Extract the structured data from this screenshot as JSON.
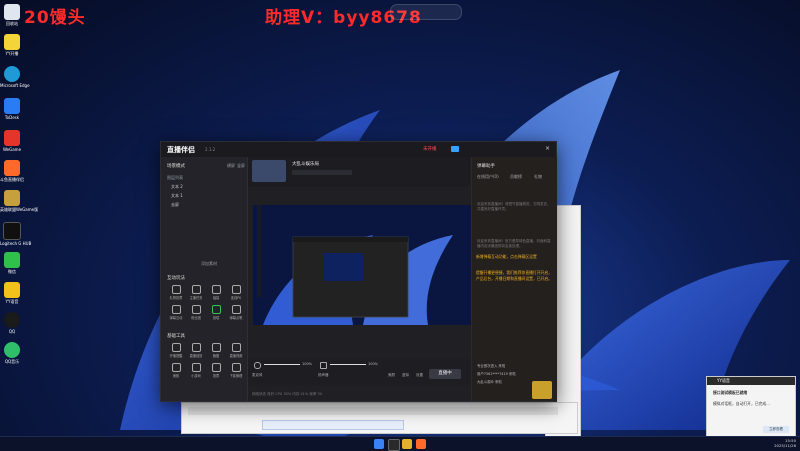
{
  "overlay": {
    "left": "20馒头",
    "right": "助理V：byy8678"
  },
  "desktop_icons": [
    {
      "label": "回收站",
      "color": "#dfe6f0"
    },
    {
      "label": "YY开播",
      "color": "#f3d53a"
    },
    {
      "label": "Microsoft Edge",
      "color": "#1f9ad6"
    },
    {
      "label": "ToDesk",
      "color": "#2a7cf5"
    },
    {
      "label": "WeGame",
      "color": "#e5352b"
    },
    {
      "label": "斗鱼直播伴侣",
      "color": "#ff6a2a"
    },
    {
      "label": "英雄联盟WeGame版",
      "color": "#c6a03c"
    },
    {
      "label": "Logitech G HUB",
      "color": "#101010"
    },
    {
      "label": "微信",
      "color": "#2fbf4a"
    },
    {
      "label": "YY语音",
      "color": "#f2c21a"
    },
    {
      "label": "QQ",
      "color": "#1a1a1a"
    },
    {
      "label": "QQ音乐",
      "color": "#2fbf6a"
    }
  ],
  "app": {
    "logo": "直播伴侣",
    "version": "2.1.2",
    "live_status": "未开播",
    "room_title": "大乱斗娱乐局",
    "sidebar": {
      "scene_label": "场景模式",
      "scene_tabs": [
        "横屏",
        "竖屏"
      ],
      "source_label": "图层列表",
      "items": [
        "文本 2",
        "文本 1",
        "去屏"
      ],
      "add_source": "添加素材",
      "interact_label": "互动玩法",
      "interact_icons": [
        "礼物投票",
        "主播任务",
        "福袋",
        "连线PK",
        "弹幕互动",
        "粉丝团",
        "投喂",
        "弹幕点歌"
      ],
      "tools_label": "基础工具",
      "tool_icons": [
        "开播提醒",
        "直播回放",
        "截图",
        "直播视频",
        "美颜",
        "小游戏",
        "投票",
        "下载管理"
      ]
    },
    "controls": {
      "mic_label": "麦克风",
      "mic_value": "100%",
      "speaker_label": "扬声器",
      "speaker_value": "100%",
      "mode_items": [
        "美颜",
        "虚拟",
        "设置"
      ],
      "start_button": "直播中"
    },
    "statusbar": "网络状态 良好  CPU 30%  内存 41%  帧率 30",
    "right_panel": {
      "title": "弹幕助手",
      "tabs": [
        "在线用户(0)",
        "贡献榜",
        "礼物"
      ],
      "notice_1": "欢迎来到直播间！请遵守直播规范，文明发言，共建良好直播环境。",
      "notice_2": "欢迎来到直播间！官方倡导绿色直播，封面和直播内容涉嫌违规将会被处理。",
      "highlight_1": "新增弹幕互动功能，点击弹幕区设置",
      "highlight_2": "提醒开播更便捷，我们推荐你直播打开开启，产品后台，开播日期和直播间设置，已开启。",
      "chat": [
        "专业首次进入 来啦",
        "用户7561****7419 来啦",
        "大乱斗观众 来啦"
      ]
    }
  },
  "toast": {
    "app": "YY语音",
    "title": "接口测试模板已就绪",
    "body": "模拟对话框，自动打开，已完成…",
    "button": "立即查看"
  },
  "clock": {
    "time": "15:50",
    "date": "2025/11/26"
  }
}
